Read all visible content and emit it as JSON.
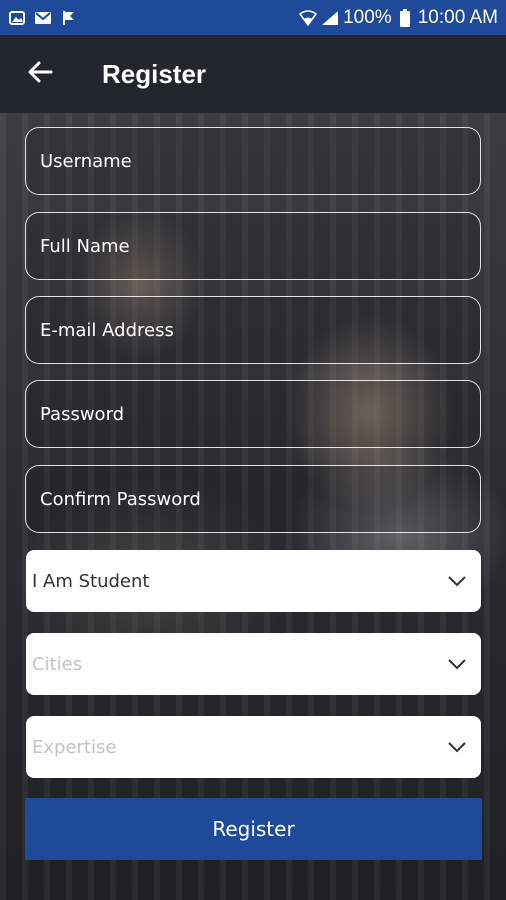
{
  "status_bar": {
    "battery": "100%",
    "time": "10:00 AM"
  },
  "app_bar": {
    "title": "Register"
  },
  "form": {
    "username_placeholder": "Username",
    "fullname_placeholder": "Full Name",
    "email_placeholder": "E-mail Address",
    "password_placeholder": "Password",
    "confirm_password_placeholder": "Confirm Password",
    "role_value": "I Am Student",
    "cities_placeholder": "Cities",
    "expertise_placeholder": "Expertise",
    "submit_label": "Register"
  },
  "colors": {
    "primary": "#1f4a9a",
    "app_bar": "#22262d"
  }
}
